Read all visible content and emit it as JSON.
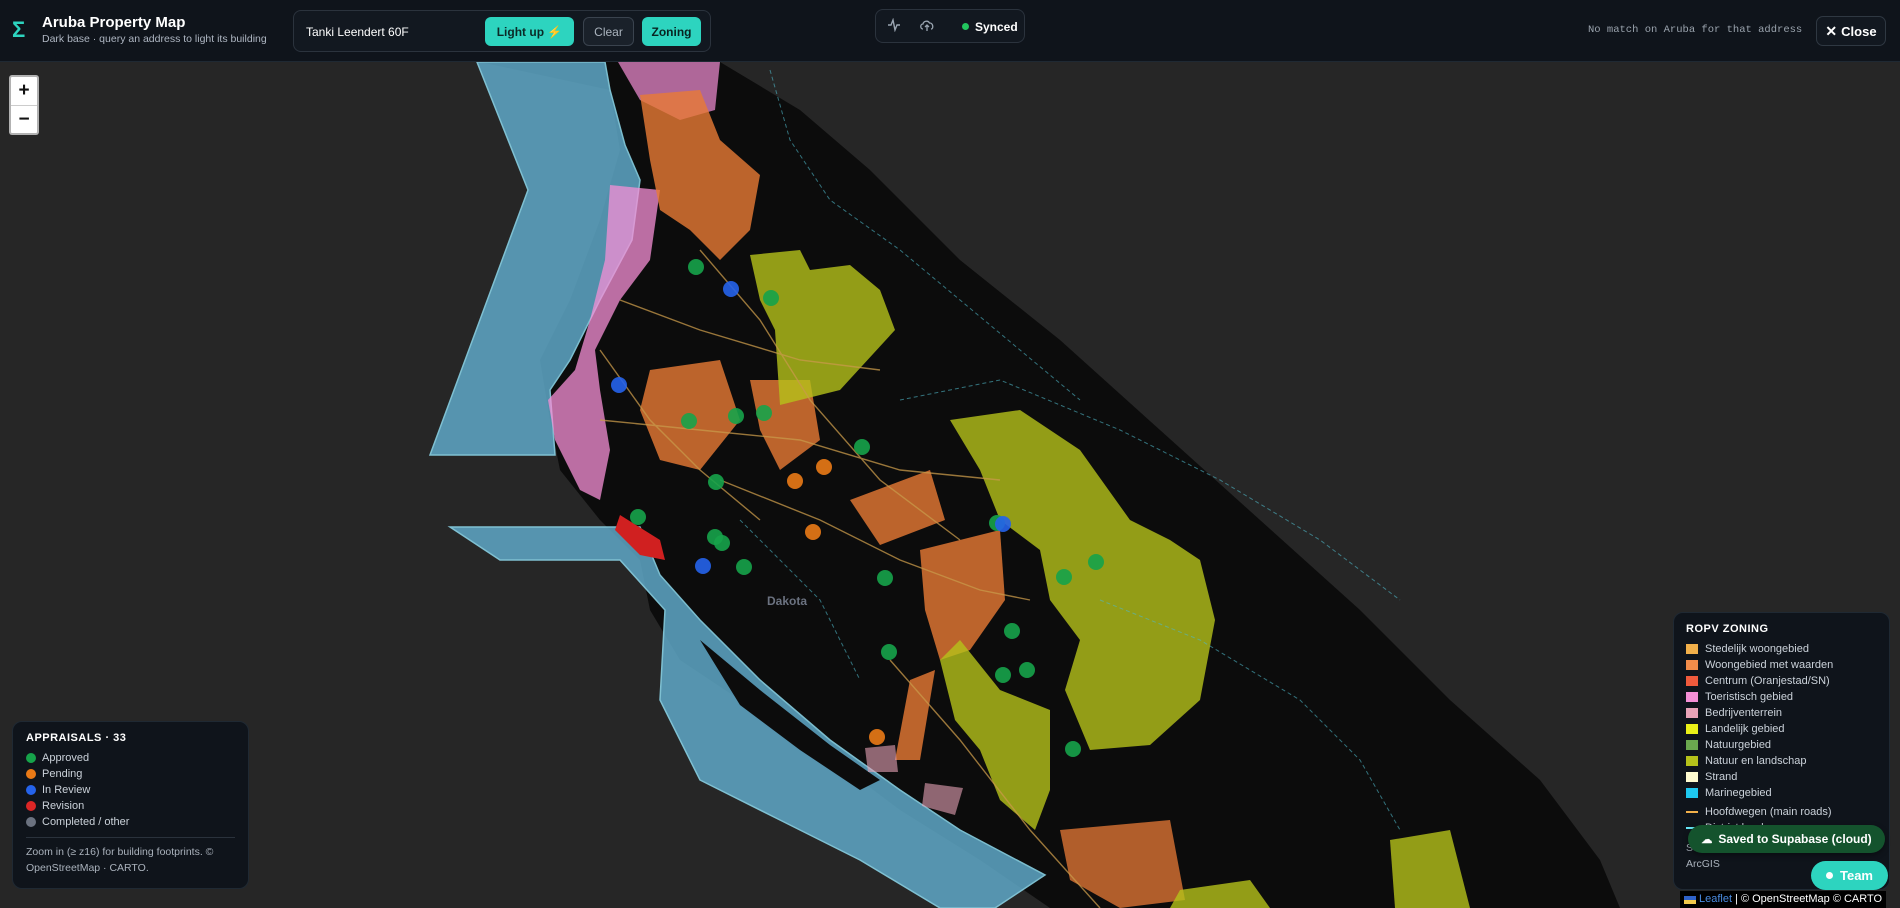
{
  "header": {
    "logo_glyph": "Σ",
    "title": "Aruba Property Map",
    "subtitle": "Dark base · query an address to light its building"
  },
  "search": {
    "value": "Tanki Leendert 60F",
    "light_up_label": "Light up ⚡",
    "clear_label": "Clear",
    "zoning_label": "Zoning"
  },
  "status": {
    "activity_icon": "activity-icon",
    "cloud_icon": "cloud-upload-icon",
    "sync_label": "Synced",
    "no_match_text": "No match on Aruba for that address",
    "close_label": "Close"
  },
  "map": {
    "zoom_in": "+",
    "zoom_out": "−",
    "place_label": "Dakota"
  },
  "appraisals": {
    "title": "APPRAISALS · 33",
    "items": [
      {
        "label": "Approved",
        "color": "#16a34a"
      },
      {
        "label": "Pending",
        "color": "#ea7a16"
      },
      {
        "label": "In Review",
        "color": "#2563eb"
      },
      {
        "label": "Revision",
        "color": "#dc2626"
      },
      {
        "label": "Completed / other",
        "color": "#6b7280"
      }
    ],
    "note_line1": "Zoom in (≥ z16) for building footprints. ©",
    "note_line2": "OpenStreetMap · CARTO."
  },
  "zoning": {
    "title": "ROPV ZONING",
    "items": [
      {
        "label": "Stedelijk woongebied",
        "color": "#f2b04a"
      },
      {
        "label": "Woongebied met waarden",
        "color": "#f28c4a"
      },
      {
        "label": "Centrum (Oranjestad/SN)",
        "color": "#f05a3c"
      },
      {
        "label": "Toeristisch gebied",
        "color": "#f58fd6"
      },
      {
        "label": "Bedrijventerrein",
        "color": "#e8a3b8"
      },
      {
        "label": "Landelijk gebied",
        "color": "#eaf018"
      },
      {
        "label": "Natuurgebied",
        "color": "#6aa84f"
      },
      {
        "label": "Natuur en landschap",
        "color": "#b5c21a"
      },
      {
        "label": "Strand",
        "color": "#fffbd0"
      },
      {
        "label": "Marinegebied",
        "color": "#1ec8f0"
      }
    ],
    "roads_label": "Hoofdwegen (main roads)",
    "borders_label": "District borders",
    "source_line1": "Source: ROPV Aruba (TOS) · live",
    "source_line2": "ArcGIS"
  },
  "toast": {
    "label": "Saved to Supabase (cloud)",
    "icon": "cloud-icon"
  },
  "team": {
    "label": "Team"
  },
  "attribution": {
    "leaflet": "Leaflet",
    "rest": "| © OpenStreetMap © CARTO"
  }
}
